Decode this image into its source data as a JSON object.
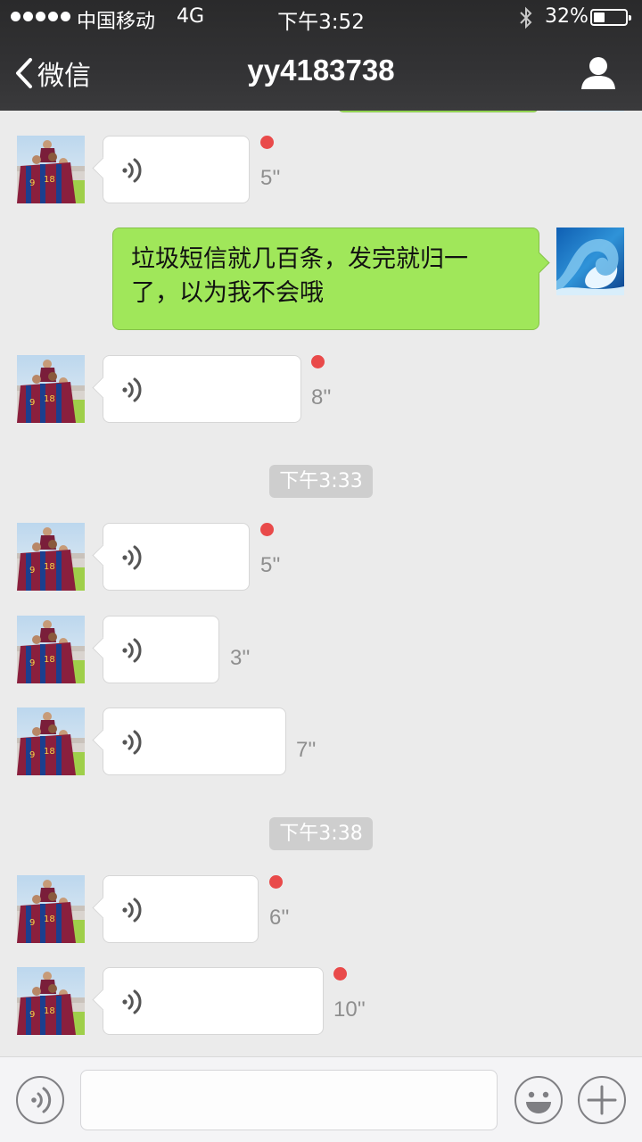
{
  "status_bar": {
    "carrier": "中国移动",
    "network": "4G",
    "time": "下午3:52",
    "battery": "32%",
    "battery_level": 0.32
  },
  "header": {
    "back_label": "微信",
    "title": "yy4183738"
  },
  "messages": [
    {
      "type": "voice",
      "side": "left",
      "duration": "5''",
      "unread": true
    },
    {
      "type": "text",
      "side": "right",
      "text_line1": "垃圾短信就几百条，发完就归一",
      "text_line2": "了，以为我不会哦"
    },
    {
      "type": "voice",
      "side": "left",
      "duration": "8''",
      "unread": true
    },
    {
      "type": "time",
      "text": "下午3:33"
    },
    {
      "type": "voice",
      "side": "left",
      "duration": "5''",
      "unread": true
    },
    {
      "type": "voice",
      "side": "left",
      "duration": "3''",
      "unread": false
    },
    {
      "type": "voice",
      "side": "left",
      "duration": "7''",
      "unread": false
    },
    {
      "type": "time",
      "text": "下午3:38"
    },
    {
      "type": "voice",
      "side": "left",
      "duration": "6''",
      "unread": true
    },
    {
      "type": "voice",
      "side": "left",
      "duration": "10''",
      "unread": true
    }
  ],
  "input_bar": {
    "voice_icon": "voice-mode-icon",
    "emoji_icon": "emoji-icon",
    "plus_icon": "plus-icon"
  },
  "colors": {
    "header_bg": "#323234",
    "chat_bg": "#ebebeb",
    "sent_bubble": "#a0e75a",
    "unread_dot": "#e94a4a",
    "time_badge": "#cecece"
  }
}
